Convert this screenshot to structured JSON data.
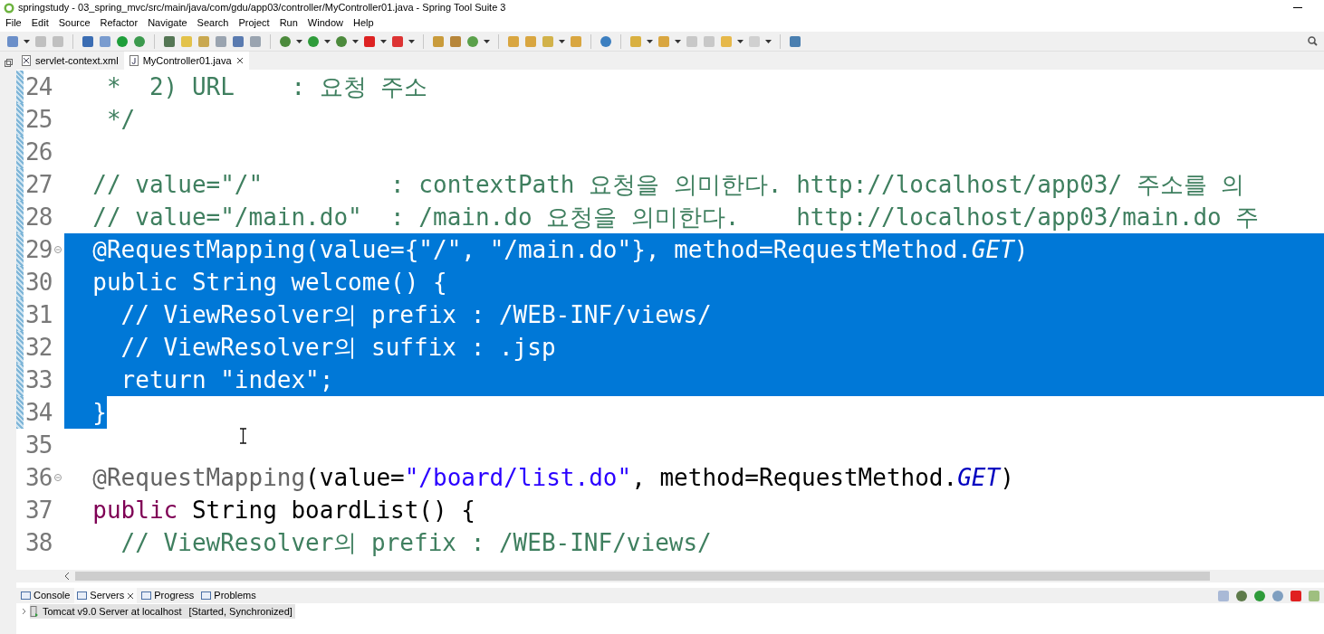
{
  "window": {
    "title": "springstudy - 03_spring_mvc/src/main/java/com/gdu/app03/controller/MyController01.java - Spring Tool Suite 3"
  },
  "menu": [
    "File",
    "Edit",
    "Source",
    "Refactor",
    "Navigate",
    "Search",
    "Project",
    "Run",
    "Window",
    "Help"
  ],
  "editor_tabs": [
    {
      "label": "servlet-context.xml",
      "selected": false,
      "kind": "xml"
    },
    {
      "label": "MyController01.java",
      "selected": true,
      "kind": "java"
    }
  ],
  "code_lines": [
    {
      "number": "24",
      "changed": true,
      "fold": false,
      "selected": false,
      "tokens": [
        {
          "kind": "comment",
          "text": "   *  2) URL    : 요청 주소"
        }
      ]
    },
    {
      "number": "25",
      "changed": true,
      "fold": false,
      "selected": false,
      "tokens": [
        {
          "kind": "comment",
          "text": "   */"
        }
      ]
    },
    {
      "number": "26",
      "changed": true,
      "fold": false,
      "selected": false
    },
    {
      "number": "27",
      "changed": true,
      "fold": false,
      "selected": false,
      "tokens": [
        {
          "kind": "comment",
          "text": "  // value=\"/\"         : contextPath 요청을 의미한다. http://localhost/app03/ 주소를 의"
        }
      ]
    },
    {
      "number": "28",
      "changed": true,
      "fold": false,
      "selected": false,
      "tokens": [
        {
          "kind": "comment",
          "text": "  // value=\"/main.do\"  : /main.do 요청을 의미한다.    http://localhost/app03/main.do 주"
        }
      ]
    },
    {
      "number": "29",
      "changed": true,
      "fold": true,
      "selected": true,
      "tokens": [
        {
          "kind": "annotation",
          "text": "  @RequestMapping"
        },
        {
          "kind": "plain",
          "text": "(value={"
        },
        {
          "kind": "string",
          "text": "\"/\""
        },
        {
          "kind": "plain",
          "text": ", "
        },
        {
          "kind": "string",
          "text": "\"/main.do\""
        },
        {
          "kind": "plain",
          "text": "}, method=RequestMethod."
        },
        {
          "kind": "constant",
          "text": "GET"
        },
        {
          "kind": "plain",
          "text": ")"
        }
      ]
    },
    {
      "number": "30",
      "changed": true,
      "fold": false,
      "selected": true,
      "tokens": [
        {
          "kind": "keyword",
          "text": "  public"
        },
        {
          "kind": "plain",
          "text": " String welcome() {"
        }
      ]
    },
    {
      "number": "31",
      "changed": true,
      "fold": false,
      "selected": true,
      "tokens": [
        {
          "kind": "comment",
          "text": "    // ViewResolver의 prefix : /WEB-INF/views/"
        }
      ]
    },
    {
      "number": "32",
      "changed": true,
      "fold": false,
      "selected": true,
      "tokens": [
        {
          "kind": "comment",
          "text": "    // ViewResolver의 suffix : .jsp"
        }
      ]
    },
    {
      "number": "33",
      "changed": true,
      "fold": false,
      "selected": true,
      "tokens": [
        {
          "kind": "keyword",
          "text": "    return "
        },
        {
          "kind": "string",
          "text": "\"index\""
        },
        {
          "kind": "plain",
          "text": ";"
        }
      ]
    },
    {
      "number": "34",
      "changed": true,
      "fold": false,
      "selected": true,
      "tokens": [
        {
          "kind": "plain",
          "text": "  }"
        }
      ]
    },
    {
      "number": "35",
      "changed": false,
      "fold": false,
      "selected": false
    },
    {
      "number": "36",
      "changed": false,
      "fold": true,
      "selected": false,
      "tokens": [
        {
          "kind": "annotation",
          "text": "  @RequestMapping"
        },
        {
          "kind": "plain",
          "text": "(value="
        },
        {
          "kind": "string",
          "text": "\"/board/list.do\""
        },
        {
          "kind": "plain",
          "text": ", method=RequestMethod."
        },
        {
          "kind": "constant",
          "text": "GET"
        },
        {
          "kind": "plain",
          "text": ")"
        }
      ]
    },
    {
      "number": "37",
      "changed": false,
      "fold": false,
      "selected": false,
      "tokens": [
        {
          "kind": "keyword",
          "text": "  public"
        },
        {
          "kind": "plain",
          "text": " String boardList() {"
        }
      ]
    },
    {
      "number": "38",
      "changed": false,
      "fold": false,
      "selected": false,
      "tokens": [
        {
          "kind": "comment",
          "text": "    // ViewResolver의 prefix : /WEB-INF/views/"
        }
      ]
    }
  ],
  "bottom_tabs": [
    {
      "label": "Console",
      "selected": false
    },
    {
      "label": "Servers",
      "selected": true
    },
    {
      "label": "Progress",
      "selected": false
    },
    {
      "label": "Problems",
      "selected": false
    }
  ],
  "servers": [
    {
      "name": "Tomcat v9.0 Server at localhost",
      "status": "[Started, Synchronized]",
      "selected": true
    }
  ]
}
